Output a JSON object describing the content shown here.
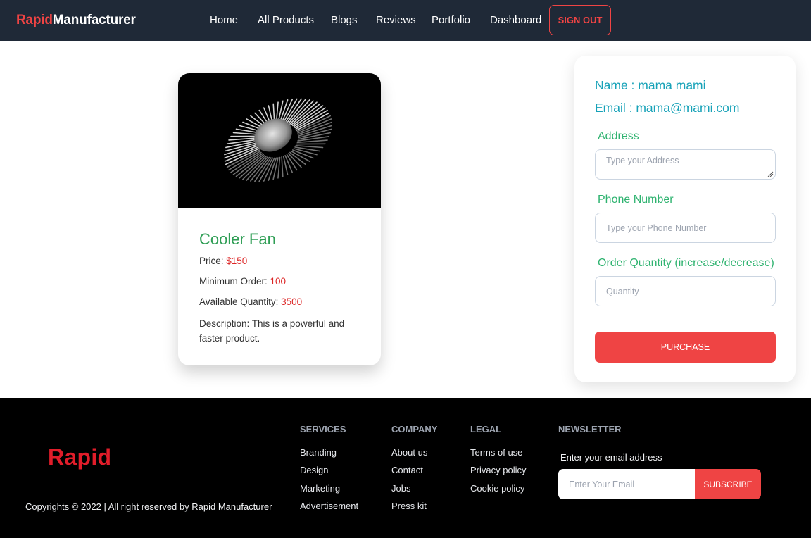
{
  "navbar": {
    "brand_part1": "Rapid",
    "brand_part2": "Manufacturer",
    "links": [
      "Home",
      "All Products",
      "Blogs",
      "Reviews",
      "Portfolio",
      "Dashboard"
    ],
    "signout_label": "SIGN OUT"
  },
  "product": {
    "image_icon": "cooler-fan-image",
    "title": "Cooler Fan",
    "price_label": "Price:",
    "price_value": "$150",
    "min_order_label": "Minimum Order:",
    "min_order_value": "100",
    "available_label": "Available Quantity:",
    "available_value": "3500",
    "description": "Description: This is a powerful and faster product."
  },
  "order_form": {
    "name_line": "Name : mama mami",
    "email_line": "Email : mama@mami.com",
    "address_label": "Address",
    "address_placeholder": "Type your Address",
    "phone_label": "Phone Number",
    "phone_placeholder": "Type your Phone Number",
    "quantity_label": "Order Quantity (increase/decrease)",
    "quantity_placeholder": "Quantity",
    "purchase_label": "PURCHASE"
  },
  "footer": {
    "logo_text": "Rapid",
    "copyright": "Copyrights © 2022 | All right reserved by Rapid Manufacturer",
    "columns": [
      {
        "title": "SERVICES",
        "links": [
          "Branding",
          "Design",
          "Marketing",
          "Advertisement"
        ]
      },
      {
        "title": "COMPANY",
        "links": [
          "About us",
          "Contact",
          "Jobs",
          "Press kit"
        ]
      },
      {
        "title": "LEGAL",
        "links": [
          "Terms of use",
          "Privacy policy",
          "Cookie policy"
        ]
      }
    ],
    "newsletter": {
      "title": "NEWSLETTER",
      "label": "Enter your email address",
      "placeholder": "Enter Your Email",
      "button": "SUBSCRIBE"
    }
  },
  "colors": {
    "nav_bg": "#1f2937",
    "accent_red": "#ef4444",
    "title_green": "#2f9e55",
    "label_green": "#2fb370",
    "user_info_teal": "#17a2b8",
    "footer_bg": "#000000"
  }
}
